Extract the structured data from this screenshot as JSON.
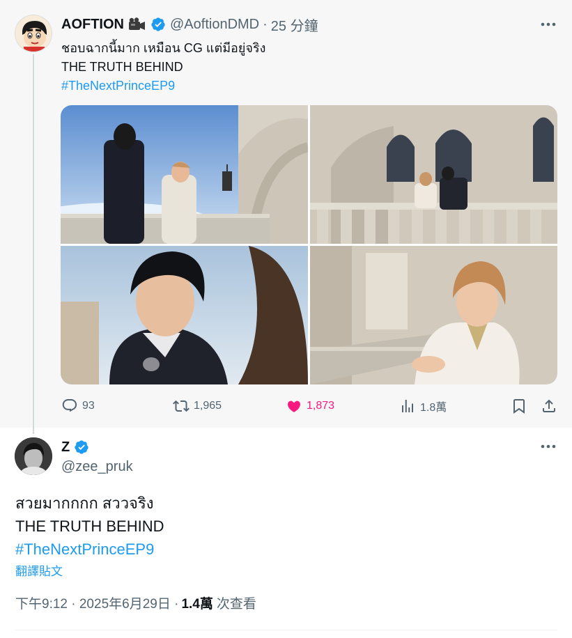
{
  "parent_tweet": {
    "author_name": "AOFTION",
    "author_handle": "@AoftionDMD",
    "separator": "·",
    "time": "25 分鐘",
    "text_line1": "ชอบฉากนี้มาก เหมือน CG แต่มีอยู่จริง",
    "text_line2": "THE TRUTH BEHIND",
    "hashtag": "#TheNextPrinceEP9",
    "stats": {
      "replies": "93",
      "reposts": "1,965",
      "likes": "1,873",
      "views": "1.8萬"
    },
    "icons": [
      "camera-icon",
      "verified-icon",
      "more-icon",
      "reply-icon",
      "repost-icon",
      "like-icon",
      "views-icon",
      "bookmark-icon",
      "share-icon"
    ]
  },
  "main_tweet": {
    "author_name": "Z",
    "author_handle": "@zee_pruk",
    "text_line1": "สวยมากกกก สววจริง",
    "text_line2": "THE TRUTH BEHIND",
    "hashtag": "#TheNextPrinceEP9",
    "translate_label": "翻譯貼文",
    "timestamp": "下午9:12 · 2025年6月29日 ·",
    "views_count": "1.4萬",
    "views_label": "次查看"
  },
  "colors": {
    "link": "#1d9bf0",
    "like": "#f91880",
    "muted": "#536471",
    "text": "#0f1419",
    "verified": "#1d9bf0"
  }
}
